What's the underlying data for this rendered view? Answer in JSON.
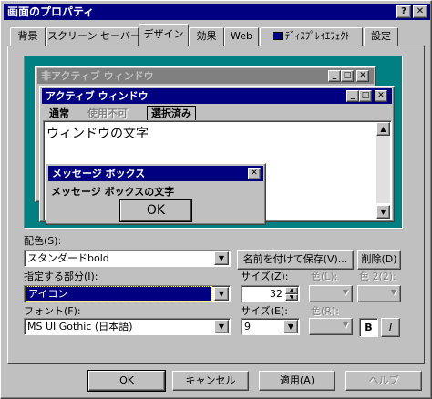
{
  "window": {
    "title": "画面のプロパティ",
    "help_btn": "?",
    "close_btn": "✕"
  },
  "tabs": [
    {
      "label": "背景"
    },
    {
      "label": "スクリーン セーバー"
    },
    {
      "label": "デザイン"
    },
    {
      "label": "効果"
    },
    {
      "label": "Web"
    },
    {
      "label": "ﾃﾞｨｽﾌﾟﾚｲｴﾌｪｸﾄ"
    },
    {
      "label": "設定"
    }
  ],
  "preview": {
    "inactive_title": "非アクティブ ウィンドウ",
    "active_title": "アクティブ ウィンドウ",
    "menu_normal": "通常",
    "menu_disabled": "使用不可",
    "menu_selected": "選択済み",
    "window_text": "ウィンドウの文字",
    "msgbox_title": "メッセージ ボックス",
    "msgbox_text": "メッセージ ボックスの文字",
    "msgbox_ok": "OK"
  },
  "scheme": {
    "label": "配色(S):",
    "value": "スタンダードbold",
    "save_as": "名前を付けて保存(V)...",
    "delete": "削除(D)"
  },
  "item": {
    "label": "指定する部分(I):",
    "value": "アイコン",
    "size_label": "サイズ(Z):",
    "size_value": "32",
    "color1_label": "色(L):",
    "color2_label": "色 2(2):"
  },
  "font": {
    "label": "フォント(F):",
    "value": "MS UI Gothic (日本語)",
    "size_label": "サイズ(E):",
    "size_value": "9",
    "color_label": "色(R):",
    "bold": "B",
    "italic": "I"
  },
  "buttons": {
    "ok": "OK",
    "cancel": "キャンセル",
    "apply": "適用(A)",
    "help": "ヘルプ"
  }
}
